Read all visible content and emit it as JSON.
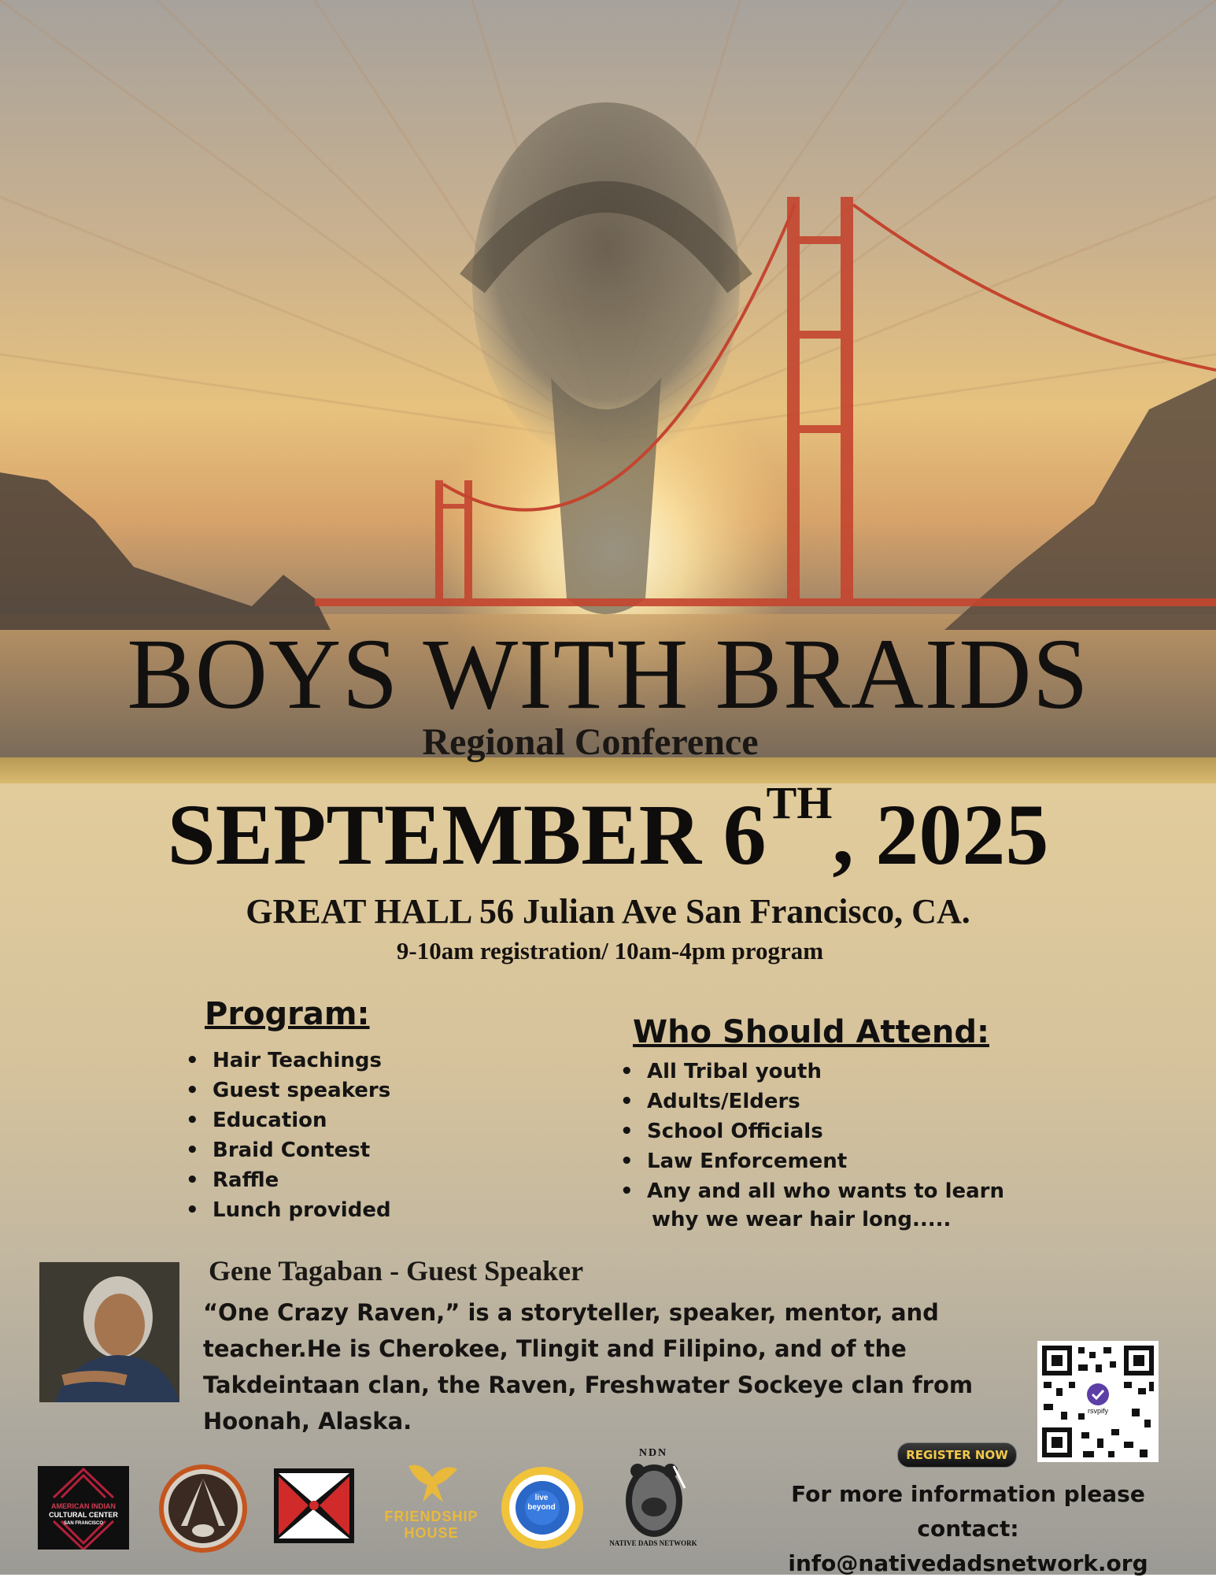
{
  "header": {
    "title": "BOYS WITH BRAIDS",
    "subtitle": "Regional Conference"
  },
  "event": {
    "date_main": "SEPTEMBER 6",
    "date_suffix": "TH",
    "date_year": ", 2025",
    "venue": "GREAT HALL 56 Julian Ave San Francisco, CA.",
    "hours": "9-10am registration/ 10am-4pm program"
  },
  "program": {
    "heading": "Program:",
    "items": [
      "Hair Teachings",
      "Guest speakers",
      "Education",
      "Braid Contest",
      "Raffle",
      "Lunch provided"
    ]
  },
  "attend": {
    "heading": "Who Should Attend:",
    "items": [
      "All Tribal youth",
      "Adults/Elders",
      "School Officials",
      "Law Enforcement",
      "Any and all who wants to learn"
    ],
    "continuation": "why we wear hair long....."
  },
  "speaker": {
    "name": "Gene Tagaban - Guest Speaker",
    "bio": "“One Crazy Raven,” is a storyteller, speaker, mentor, and teacher.He is Cherokee, Tlingit and Filipino, and of the Takdeintaan clan, the Raven, Freshwater Sockeye clan from Hoonah, Alaska."
  },
  "register": {
    "label": "REGISTER NOW",
    "qr_badge": "rsvpify"
  },
  "contact": {
    "line1": "For more information please contact:",
    "email": "info@nativedadsnetwork.org"
  },
  "logos": {
    "aicc_line1": "AMERICAN INDIAN",
    "aicc_line2": "CULTURAL CENTER",
    "aicc_line3": "SAN FRANCISCO",
    "friendship_line1": "FRIENDSHIP",
    "friendship_line2": "HOUSE",
    "livebeyond_line1": "live",
    "livebeyond_line2": "beyond",
    "ndn_top": "NDN",
    "ndn_bottom": "NATIVE DADS NETWORK"
  },
  "colors": {
    "bridge": "#c4452f",
    "accent_gold": "#d9bb72",
    "friendship_gold": "#e9b93b",
    "register_text": "#f2c84b"
  }
}
